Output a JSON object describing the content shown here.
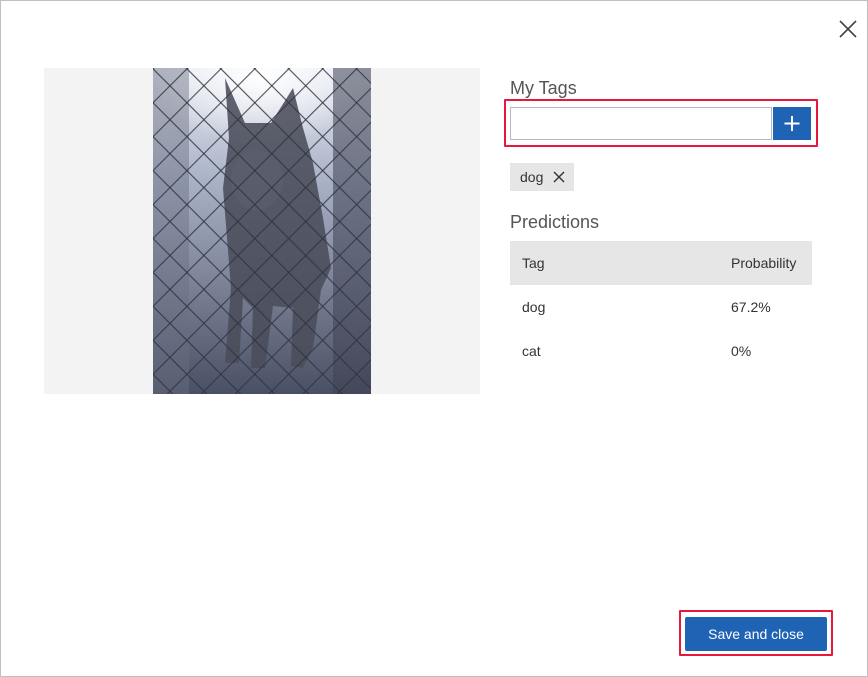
{
  "dialog": {
    "close_icon": "close-icon"
  },
  "image": {
    "description_icon": "dog-photo"
  },
  "my_tags": {
    "title": "My Tags",
    "input_value": "",
    "input_placeholder": "",
    "add_icon": "plus-icon",
    "tags": [
      {
        "label": "dog",
        "remove_icon": "close-icon"
      }
    ]
  },
  "predictions": {
    "title": "Predictions",
    "columns": [
      "Tag",
      "Probability"
    ],
    "rows": [
      {
        "tag": "dog",
        "probability": "67.2%"
      },
      {
        "tag": "cat",
        "probability": "0%"
      }
    ]
  },
  "footer": {
    "save_label": "Save and close"
  },
  "colors": {
    "accent": "#1f63b5",
    "highlight": "#e8173d",
    "table_header_bg": "#e6e6e6",
    "image_panel_bg": "#f3f3f3"
  }
}
